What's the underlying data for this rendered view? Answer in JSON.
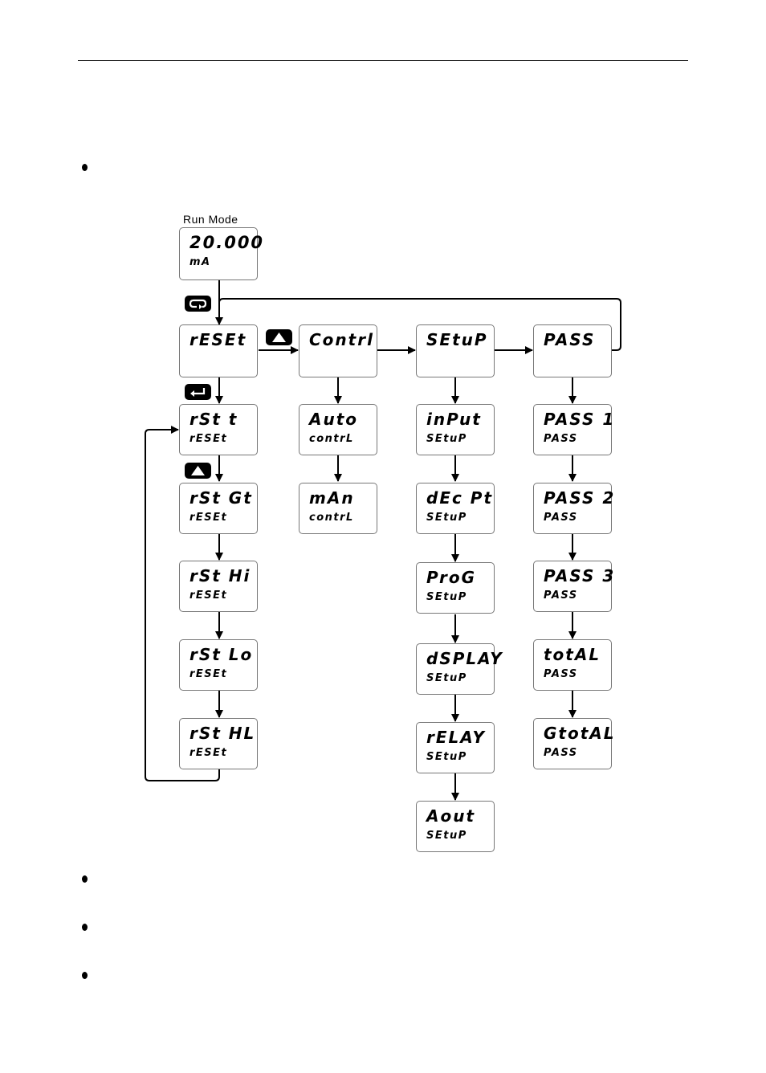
{
  "page": {
    "bullets_count": 4
  },
  "diagram": {
    "run_mode_label": "Run Mode",
    "run_display": {
      "top": "20.000",
      "bottom": "mA"
    },
    "buttons": {
      "menu": "menu-button-icon",
      "enter": "enter-button-icon",
      "up": "up-arrow-button-icon"
    },
    "columns": {
      "reset": {
        "header": {
          "top": "rESEt",
          "bottom": ""
        },
        "items": [
          {
            "top": "rSt t",
            "bottom": "rESEt"
          },
          {
            "top": "rSt Gt",
            "bottom": "rESEt"
          },
          {
            "top": "rSt Hi",
            "bottom": "rESEt"
          },
          {
            "top": "rSt Lo",
            "bottom": "rESEt"
          },
          {
            "top": "rSt HL",
            "bottom": "rESEt"
          }
        ]
      },
      "control": {
        "header": {
          "top": "Contrl",
          "bottom": ""
        },
        "items": [
          {
            "top": "Auto",
            "bottom": "contrL"
          },
          {
            "top": "mAn",
            "bottom": "contrL"
          }
        ]
      },
      "setup": {
        "header": {
          "top": "SEtuP",
          "bottom": ""
        },
        "items": [
          {
            "top": "inPut",
            "bottom": "SEtuP"
          },
          {
            "top": "dEc Pt",
            "bottom": "SEtuP"
          },
          {
            "top": "ProG",
            "bottom": "SEtuP"
          },
          {
            "top": "dSPLAY",
            "bottom": "SEtuP"
          },
          {
            "top": "rELAY",
            "bottom": "SEtuP"
          },
          {
            "top": "Aout",
            "bottom": "SEtuP"
          }
        ]
      },
      "pass": {
        "header": {
          "top": "PASS",
          "bottom": ""
        },
        "items": [
          {
            "top": "PASS 1",
            "bottom": "PASS"
          },
          {
            "top": "PASS 2",
            "bottom": "PASS"
          },
          {
            "top": "PASS 3",
            "bottom": "PASS"
          },
          {
            "top": "totAL",
            "bottom": "PASS"
          },
          {
            "top": "GtotAL",
            "bottom": "PASS"
          }
        ]
      }
    }
  }
}
